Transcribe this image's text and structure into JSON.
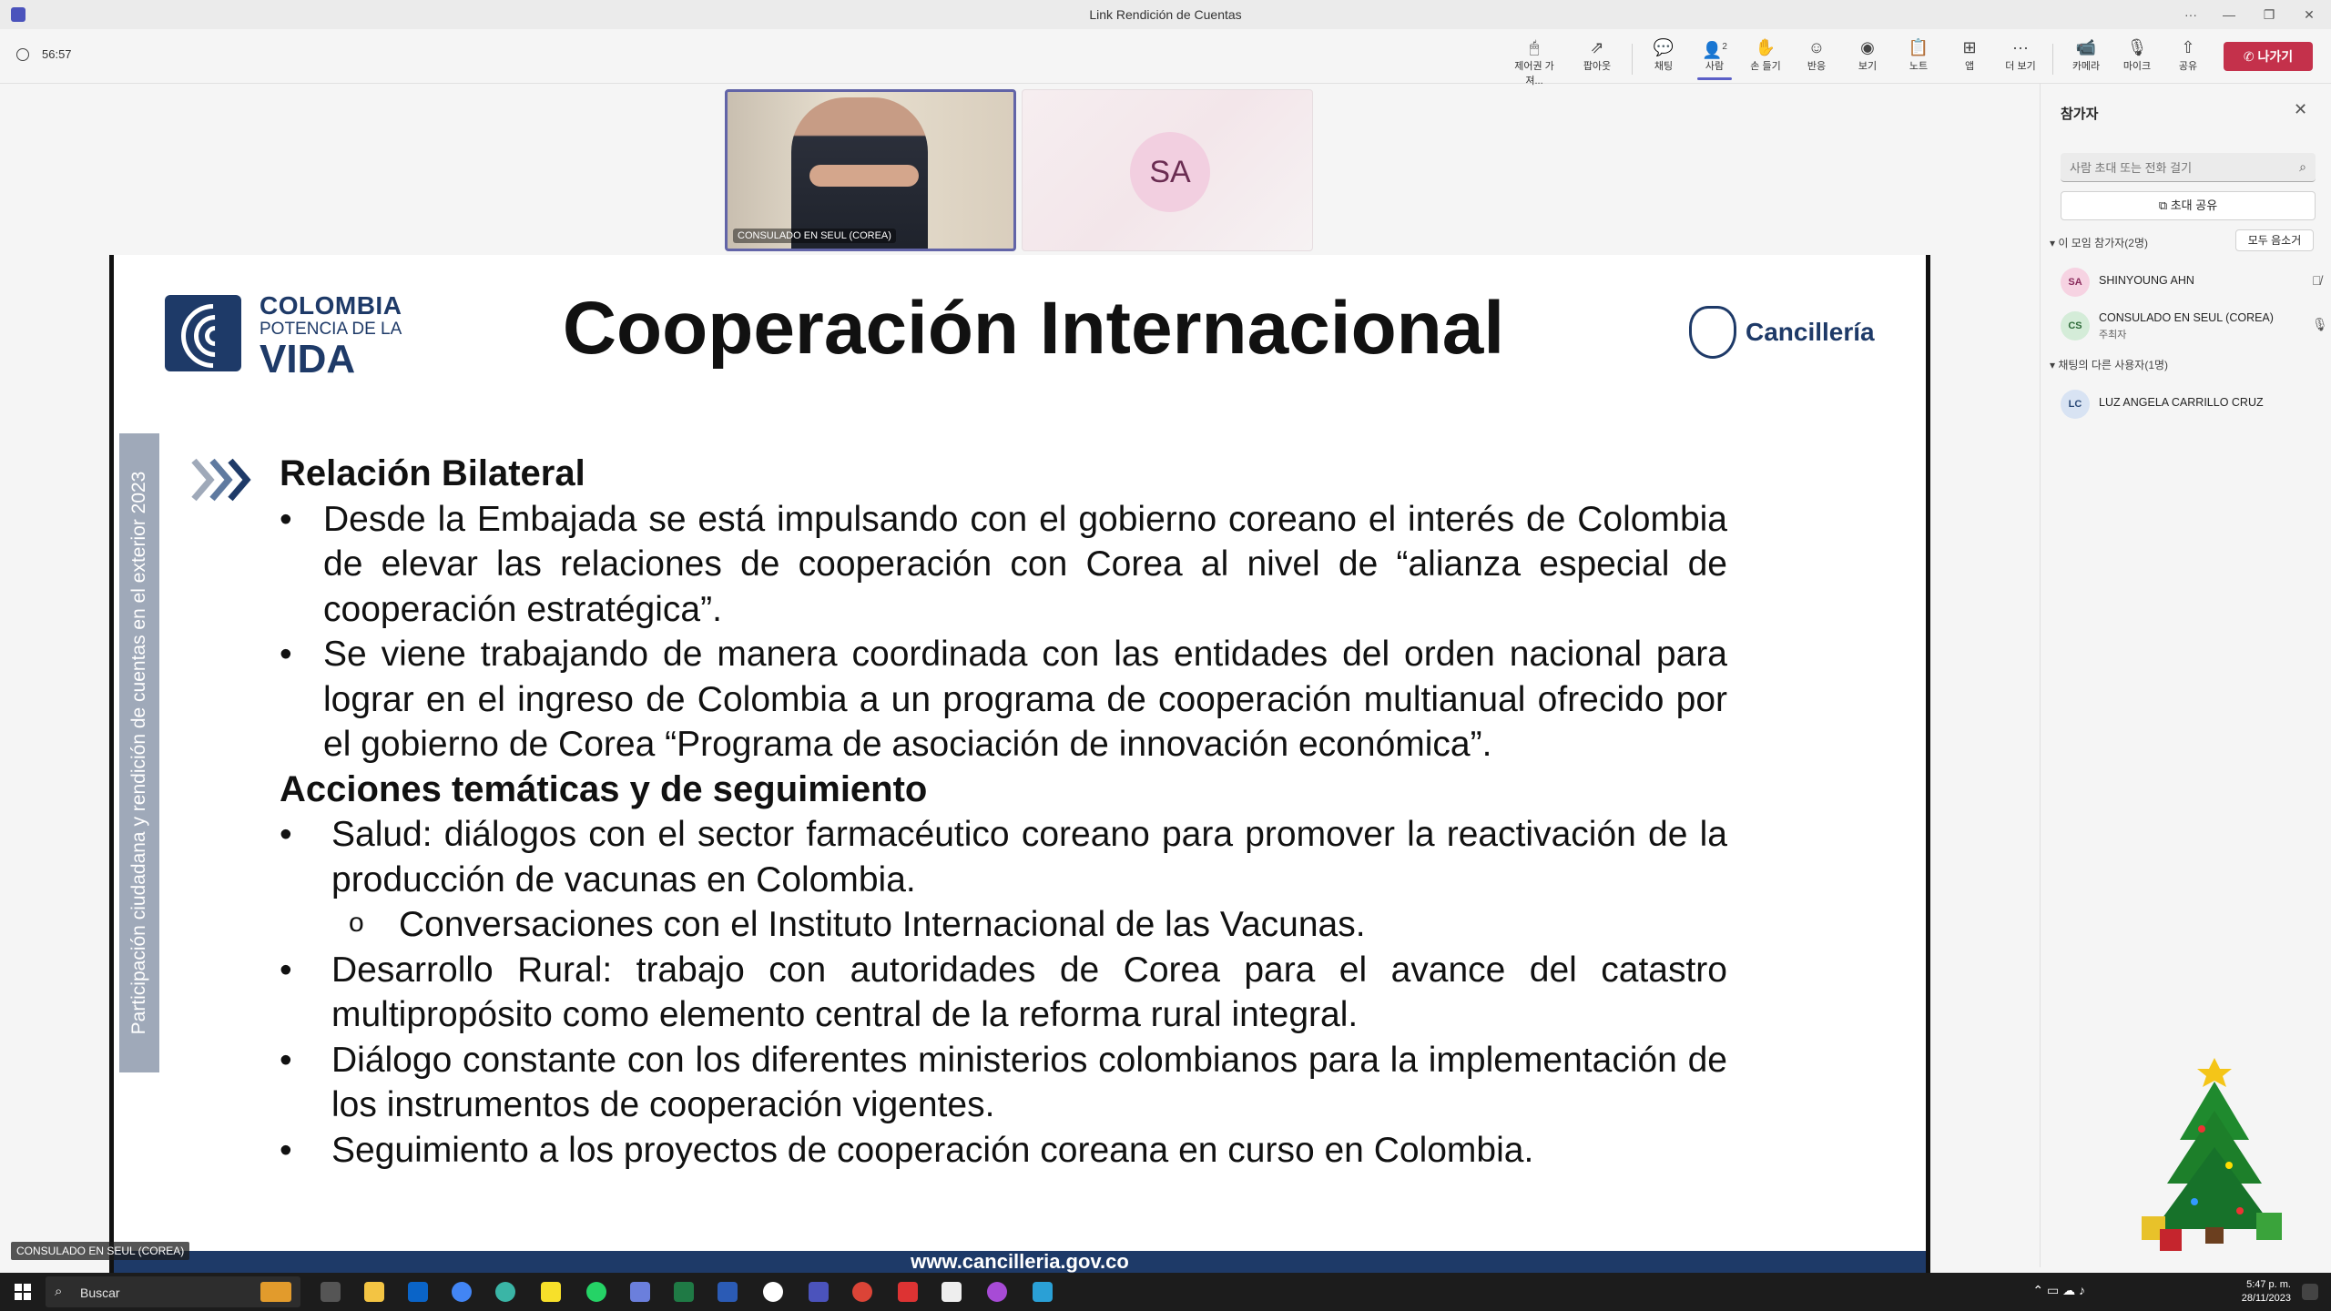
{
  "window": {
    "title": "Link Rendición de Cuentas",
    "controls": [
      "···",
      "—",
      "❐",
      "✕"
    ]
  },
  "toolbar": {
    "timer": "56:57",
    "buttons": [
      {
        "label": "제어권 가져...",
        "icon": "🖱"
      },
      {
        "label": "팝아웃",
        "icon": "⇗"
      },
      {
        "label": "채팅",
        "icon": "💬"
      },
      {
        "label": "사람",
        "icon": "👤"
      },
      {
        "label": "손 들기",
        "icon": "✋"
      },
      {
        "label": "반응",
        "icon": "☺"
      },
      {
        "label": "보기",
        "icon": "◉"
      },
      {
        "label": "노트",
        "icon": "📋"
      },
      {
        "label": "앱",
        "icon": "⊞"
      },
      {
        "label": "더 보기",
        "icon": "···"
      },
      {
        "label": "카메라",
        "icon": "📹"
      },
      {
        "label": "마이크",
        "icon": "🎙"
      },
      {
        "label": "공유",
        "icon": "⇧"
      }
    ],
    "people_count": "2",
    "leave_label": "나가기"
  },
  "videos": {
    "tile1_label": "CONSULADO EN SEUL (COREA)",
    "tile2_initials": "SA"
  },
  "slide": {
    "logo": {
      "line1": "COLOMBIA",
      "line2": "POTENCIA DE LA",
      "line3": "VIDA"
    },
    "title": "Cooperación Internacional",
    "ministry": "Cancillería",
    "side_text": "Participación ciudadana y rendición de cuentas en el exterior 2023",
    "heading1": "Relación Bilateral",
    "bullet1": "Desde la Embajada se está impulsando con el gobierno coreano el interés de Colombia de elevar las relaciones de cooperación con Corea al nivel de “alianza especial de cooperación estratégica”.",
    "bullet2": "Se viene trabajando de manera coordinada con las entidades del orden nacional para lograr en el ingreso de Colombia a un programa de cooperación multianual ofrecido por el gobierno de Corea “Programa de asociación de innovación económica”.",
    "heading2": "Acciones temáticas y de seguimiento",
    "bullet3": "Salud: diálogos con el sector farmacéutico coreano para promover la reactivación de la producción de vacunas en Colombia.",
    "subbullet1": "Conversaciones con el Instituto Internacional de las Vacunas.",
    "bullet4": "Desarrollo Rural: trabajo con autoridades de Corea para el avance del catastro multipropósito como elemento central de la reforma rural integral.",
    "bullet5": "Diálogo constante con los diferentes ministerios colombianos para la implementación de los instrumentos de cooperación vigentes.",
    "bullet6": "Seguimiento a los proyectos de cooperación coreana en curso en Colombia.",
    "footer": "www.cancilleria.gov.co"
  },
  "speaker_label": "CONSULADO EN SEUL (COREA)",
  "panel": {
    "title": "참가자",
    "search_placeholder": "사람 초대 또는 전화 걸기",
    "invite_label": "초대 공유",
    "section_meeting": "이 모임 참가자(2명)",
    "mute_all": "모두 음소거",
    "participants": [
      {
        "initials": "SA",
        "name": "SHINYOUNG AHN",
        "role": "",
        "mic": "muted"
      },
      {
        "initials": "CS",
        "name": "CONSULADO EN SEUL (COREA)",
        "role": "주최자",
        "mic": "on"
      }
    ],
    "section_other": "채팅의 다른 사용자(1명)",
    "others": [
      {
        "initials": "LC",
        "name": "LUZ ANGELA CARRILLO CRUZ"
      }
    ]
  },
  "taskbar": {
    "search_label": "Buscar",
    "time": "5:47 p. m.",
    "date": "28/11/2023"
  },
  "colors": {
    "accent": "#5b5fc7",
    "leave": "#c4314b",
    "slide_navy": "#1e3a68"
  }
}
